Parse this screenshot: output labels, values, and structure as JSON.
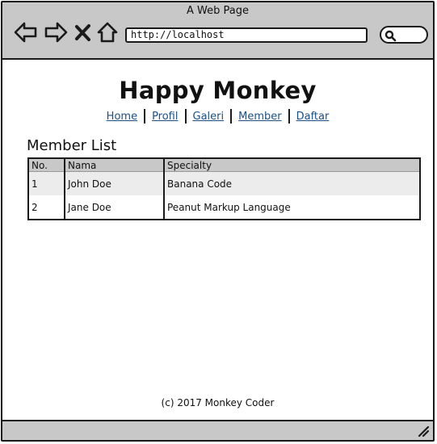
{
  "window": {
    "title": "A Web Page"
  },
  "toolbar": {
    "icons": [
      "back-arrow-icon",
      "forward-arrow-icon",
      "stop-x-icon",
      "home-icon",
      "search-icon"
    ],
    "url": "http://localhost"
  },
  "site": {
    "title": "Happy Monkey"
  },
  "menu": {
    "items": [
      "Home",
      "Profil",
      "Galeri",
      "Member",
      "Daftar"
    ]
  },
  "content": {
    "section_title": "Member List",
    "table": {
      "headers": [
        "No.",
        "Nama",
        "Specialty"
      ],
      "rows": [
        [
          "1",
          "John Doe",
          "Banana Code"
        ],
        [
          "2",
          "Jane Doe",
          "Peanut Markup Language"
        ]
      ]
    }
  },
  "footer": {
    "text": "(c) 2017 Monkey Coder"
  },
  "colors": {
    "chrome": "#c8c8c8",
    "link": "#1d4f86",
    "row_alt": "#ececec",
    "border": "#1a1a1a"
  }
}
